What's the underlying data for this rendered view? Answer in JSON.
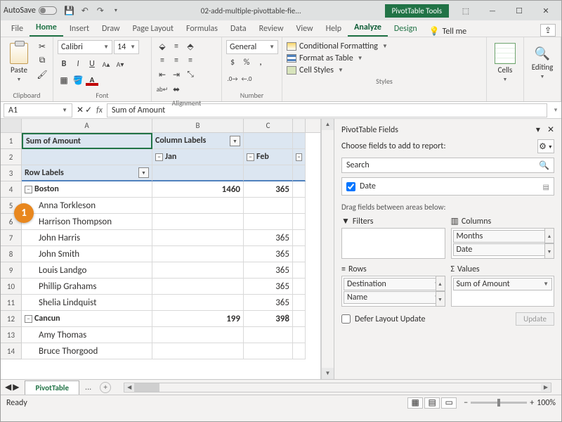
{
  "titlebar": {
    "autosave": "AutoSave",
    "filename": "02-add-multiple-pivottable-fie...",
    "pt_tools": "PivotTable Tools"
  },
  "tabs": {
    "file": "File",
    "home": "Home",
    "insert": "Insert",
    "draw": "Draw",
    "page_layout": "Page Layout",
    "formulas": "Formulas",
    "data": "Data",
    "review": "Review",
    "view": "View",
    "help": "Help",
    "analyze": "Analyze",
    "design": "Design",
    "tellme": "Tell me"
  },
  "ribbon": {
    "clipboard": {
      "paste": "Paste",
      "label": "Clipboard"
    },
    "font": {
      "name": "Calibri",
      "size": "14",
      "label": "Font"
    },
    "alignment": {
      "label": "Alignment"
    },
    "number": {
      "format": "General",
      "label": "Number"
    },
    "styles": {
      "cond": "Conditional Formatting",
      "table": "Format as Table",
      "cell": "Cell Styles",
      "label": "Styles"
    },
    "cells": {
      "label": "Cells"
    },
    "editing": {
      "label": "Editing"
    }
  },
  "namebox": "A1",
  "formula": "Sum of Amount",
  "pivot": {
    "sum_of_amount": "Sum of Amount",
    "column_labels": "Column Labels",
    "jan": "Jan",
    "feb": "Feb",
    "row_labels": "Row Labels",
    "r": [
      {
        "label": "Boston",
        "b": "1460",
        "c": "365"
      },
      {
        "label": "Anna Torkleson",
        "b": "",
        "c": ""
      },
      {
        "label": "Harrison Thompson",
        "b": "",
        "c": ""
      },
      {
        "label": "John Harris",
        "b": "",
        "c": "365"
      },
      {
        "label": "John Smith",
        "b": "",
        "c": "365"
      },
      {
        "label": "Louis Landgo",
        "b": "",
        "c": "365"
      },
      {
        "label": "Phillip Grahams",
        "b": "",
        "c": "365"
      },
      {
        "label": "Shelia Lindquist",
        "b": "",
        "c": "365"
      },
      {
        "label": "Cancun",
        "b": "199",
        "c": "398"
      },
      {
        "label": "Amy Thomas",
        "b": "",
        "c": ""
      },
      {
        "label": "Bruce Thorgood",
        "b": "",
        "c": ""
      }
    ]
  },
  "field_pane": {
    "title": "PivotTable Fields",
    "choose": "Choose fields to add to report:",
    "search": "Search",
    "date": "Date",
    "drag": "Drag fields between areas below:",
    "filters": "Filters",
    "columns": "Columns",
    "rows": "Rows",
    "values": "Values",
    "months": "Months",
    "date2": "Date",
    "dest": "Destination",
    "name": "Name",
    "sum": "Sum of Amount",
    "defer": "Defer Layout Update",
    "update": "Update",
    "sigma": "Σ"
  },
  "sheet": {
    "tab": "PivotTable"
  },
  "status": {
    "ready": "Ready",
    "zoom": "100%"
  },
  "annot": "1"
}
